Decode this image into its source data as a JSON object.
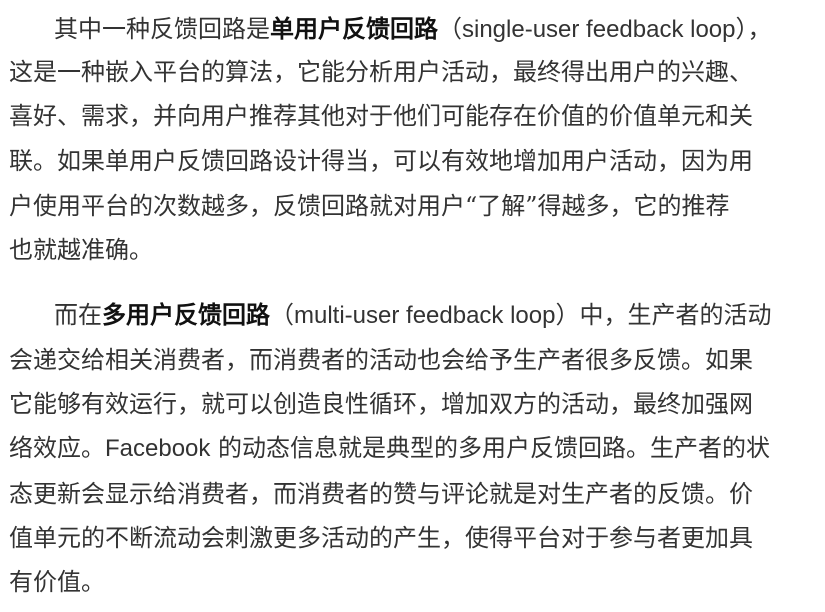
{
  "paragraph_1": {
    "lines": [
      [
        "其中一种反馈回路是",
        {
          "bold": "单用户反馈回路"
        },
        "（",
        {
          "latin": "single-user feedback loop"
        },
        "），"
      ],
      [
        "这是一种嵌入平台的算法，它能分析用户活动，最终得出用户的兴趣、"
      ],
      [
        "喜好、需求，并向用户推荐其他对于他们可能存在价值的价值单元和关"
      ],
      [
        "联。如果单用户反馈回路设计得当，可以有效地增加用户活动，因为用"
      ],
      [
        "户使用平台的次数越多，反馈回路就对用户“了解”得越多，它的推荐"
      ],
      [
        "也就越准确。"
      ]
    ]
  },
  "paragraph_2": {
    "lines": [
      [
        "而在",
        {
          "bold": "多用户反馈回路"
        },
        "（",
        {
          "latin": "multi-user feedback loop"
        },
        "）中，生产者的活动"
      ],
      [
        "会递交给相关消费者，而消费者的活动也会给予生产者很多反馈。如果"
      ],
      [
        "它能够有效运行，就可以创造良性循环，增加双方的活动，最终加强网"
      ],
      [
        "络效应。",
        {
          "latin": "Facebook"
        },
        " 的动态信息就是典型的多用户反馈回路。生产者的状"
      ],
      [
        "态更新会显示给消费者，而消费者的赞与评论就是对生产者的反馈。价"
      ],
      [
        "值单元的不断流动会刺激更多活动的产生，使得平台对于参与者更加具"
      ],
      [
        "有价值。"
      ]
    ]
  }
}
